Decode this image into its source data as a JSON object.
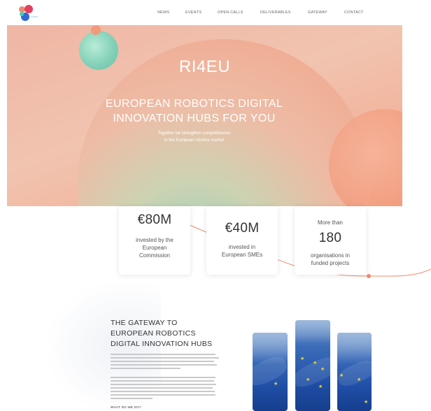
{
  "header": {
    "nav": [
      {
        "label": "NEWS"
      },
      {
        "label": "EVENTS"
      },
      {
        "label": "OPEN CALLS"
      },
      {
        "label": "DELIVERABLES"
      },
      {
        "label": "GATEWAY"
      },
      {
        "label": "CONTACT"
      }
    ]
  },
  "hero": {
    "title": "RI4EU",
    "headline_line1": "EUROPEAN ROBOTICS DIGITAL",
    "headline_line2": "INNOVATION HUBS FOR YOU",
    "sub_line1": "Together we strengthen competitivenes",
    "sub_line2": "in the European robotics market"
  },
  "stats": [
    {
      "value": "€80M",
      "text_line1": "invested by the",
      "text_line2": "European",
      "text_line3": "Commission"
    },
    {
      "value": "€40M",
      "text_line1": "invested in",
      "text_line2": "European SMEs"
    },
    {
      "prefix": "More than",
      "value": "180",
      "text_line1": "organisations in",
      "text_line2": "funded projects"
    }
  ],
  "gateway": {
    "title_line1": "THE GATEWAY TO",
    "title_line2": "EUROPEAN ROBOTICS",
    "title_line3": "DIGITAL INNOVATION HUBS",
    "what_heading": "WHAT DO WE DO?"
  },
  "colors": {
    "accent": "#f08a6e",
    "brand_red": "#e4405f",
    "brand_blue": "#2f6bd6"
  }
}
